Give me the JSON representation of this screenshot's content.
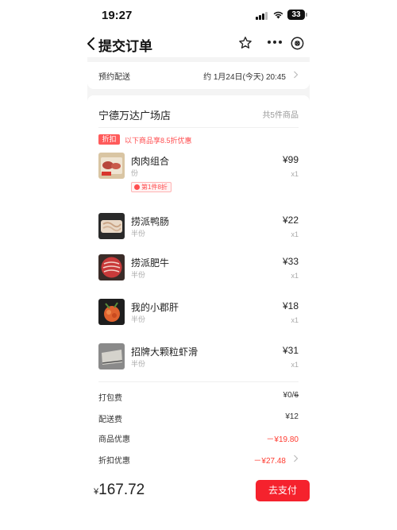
{
  "status_bar": {
    "time": "19:27",
    "battery": "33"
  },
  "nav": {
    "title": "提交订单"
  },
  "delivery": {
    "label": "预约配送",
    "value": "约 1月24日(今天) 20:45"
  },
  "store": {
    "name": "宁德万达广场店",
    "count": "共5件商品"
  },
  "promo": {
    "tag": "折扣",
    "text": "以下商品享8.5折优惠"
  },
  "items": [
    {
      "name": "肉肉组合",
      "spec": "份",
      "price": "¥99",
      "qty": "x1",
      "badge": "第1件8折"
    },
    {
      "name": "捞派鸭肠",
      "spec": "半份",
      "price": "¥22",
      "qty": "x1"
    },
    {
      "name": "捞派肥牛",
      "spec": "半份",
      "price": "¥33",
      "qty": "x1"
    },
    {
      "name": "我的小郡肝",
      "spec": "半份",
      "price": "¥18",
      "qty": "x1"
    },
    {
      "name": "招牌大颗粒虾滑",
      "spec": "半份",
      "price": "¥31",
      "qty": "x1"
    }
  ],
  "fees": {
    "packing": {
      "label": "打包费",
      "value_prefix": "¥0/",
      "value_struck": "6"
    },
    "delivery": {
      "label": "配送费",
      "value": "¥12"
    },
    "product_discount": {
      "label": "商品优惠",
      "value": "－¥19.80"
    },
    "discount": {
      "label": "折扣优惠",
      "value": "－¥27.48"
    }
  },
  "footer": {
    "currency": "¥",
    "total": "167.72",
    "pay_label": "去支付"
  },
  "colors": {
    "accent": "#f5222d",
    "discount_red": "#ff3b30"
  },
  "icons": [
    "back-icon",
    "star-icon",
    "more-icon",
    "close-circle-icon",
    "chevron-right-icon"
  ]
}
